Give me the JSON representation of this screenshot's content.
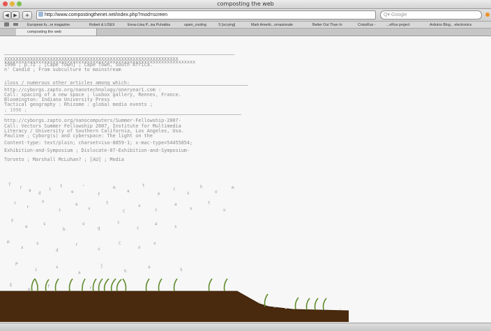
{
  "window": {
    "title": "composting the web"
  },
  "toolbar": {
    "back": "◀",
    "forward": "▶",
    "add": "+",
    "url": "http://www.compostingthenet.net/index.php?mod=screen",
    "reload": "↻",
    "search_placeholder": "Q▾ Google"
  },
  "bookmarks": [
    "European fu...re magazine",
    "Robert & LISEX",
    "Eeva-Liisa P...isa Puhakka",
    "spam_cooling",
    "S [scrying]",
    "Mark Amerik...ornazionale",
    "Better Out Than In",
    "CrisisRus -",
    "...eRus project",
    "Arduino Blog... electronics"
  ],
  "tab": {
    "label": "composting the web"
  },
  "content": {
    "block1": [
      "1996 ; p.72 ; [Cape Town] ; Cape Town, South Africa.",
      "n' Candid ; From subculture to mainstream"
    ],
    "block2": [
      "iloss / numerous other articles among which:",
      "http://cyborgs.zapto.org/nanotechnology/oneryear1.com :",
      "Call: spacing of a new space ; luxbox gallery, Rennes, France.",
      "Bloomington: Indiana University Press",
      "Tactical geography : Rhizome : global media events ;",
      "; 1996 ;"
    ],
    "block3": [
      "http://cyborgs.zapto.org/nanocomputers/Summer-Fellowship-2007-",
      "Call: Vectors Summer Fellowship 2007, Institute for Multimedia",
      "Literacy / University of Southern California, Los Angeles, Usa.",
      "Pauline ; Cyborg(s) and cyberspace: The light on the",
      "Content-type: text/plain; charset=iso-8859-1; x-mac-type=54455854;",
      "Exhibition-and-Symposium ; Dislocate-07-Exhibition-and-Symposium-",
      "Toronto ; Marshall McLuhan? ; [AU] ; Media"
    ]
  }
}
